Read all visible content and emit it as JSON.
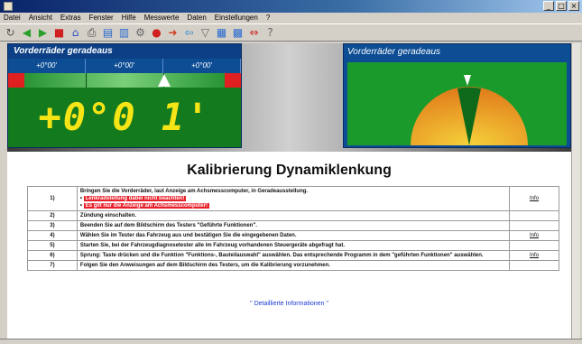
{
  "window": {
    "title": "",
    "buttons": {
      "minimize": "_",
      "maximize": "□",
      "close": "×"
    }
  },
  "menu": [
    "Datei",
    "Ansicht",
    "Extras",
    "Fenster",
    "Hilfe",
    "Messwerte",
    "Daten",
    "Einstellungen",
    "?"
  ],
  "toolbar_icons": [
    "refresh-icon",
    "back-arrow-icon",
    "forward-arrow-icon",
    "stop-icon",
    "home-icon",
    "print-icon",
    "document-icon",
    "clipboard-icon",
    "tool-icon",
    "record-icon",
    "arrow-right-icon",
    "arrow-left-icon",
    "filter-icon",
    "chart-icon",
    "grid-icon",
    "connect-icon",
    "help-icon"
  ],
  "left_panel": {
    "title": "Vorderräder geradeaus",
    "readings": [
      "+0°00'",
      "+0°00'",
      "+0°00'"
    ],
    "value": "+0°0 1'",
    "bar_position": 0.67
  },
  "right_panel": {
    "title": "Vorderräder geradeaus"
  },
  "heading": "Kalibrierung Dynamiklenkung",
  "steps": [
    {
      "num": "1)",
      "text": "Bringen Sie die Vorderräder, laut Anzeige am Achsmesscomputer, in Geradeausstellung.",
      "warnings": [
        "Lenkradstellung dabei nicht beachten!",
        "Es gilt nur die Anzeige am Achsmesscomputer!"
      ],
      "link": "Info"
    },
    {
      "num": "2)",
      "text": "Zündung einschalten.",
      "link": ""
    },
    {
      "num": "3)",
      "text": "Beenden Sie auf dem Bildschirm des Testers \"Geführte Funktionen\".",
      "link": ""
    },
    {
      "num": "4)",
      "text": "Wählen Sie im Tester das Fahrzeug aus und bestätigen Sie die eingegebenen Daten.",
      "link": "Info"
    },
    {
      "num": "5)",
      "text": "Starten Sie, bei der Fahrzeugdiagnosetester alle im Fahrzeug vorhandenen Steuergeräte abgefragt hat.",
      "link": ""
    },
    {
      "num": "6)",
      "text": "Sprung: Taste drücken und die Funktion \"Funktions-, Bauteilauswahl\" auswählen. Das entsprechende Programm in dem \"geführten Funktionen\" auswählen.",
      "link": "Info"
    },
    {
      "num": "7)",
      "text": "Folgen Sie den Anweisungen auf dem Bildschirm des Testers, um die Kalibrierung vorzunehmen.",
      "link": ""
    }
  ],
  "more_info": "\" Detaillierte Informationen \"",
  "colors": {
    "panel_blue": "#0c4d94",
    "value_yellow": "#f6e516",
    "panel_green": "#147a1e",
    "warning_red": "#e8202a",
    "link_blue": "#1a3ad6"
  }
}
